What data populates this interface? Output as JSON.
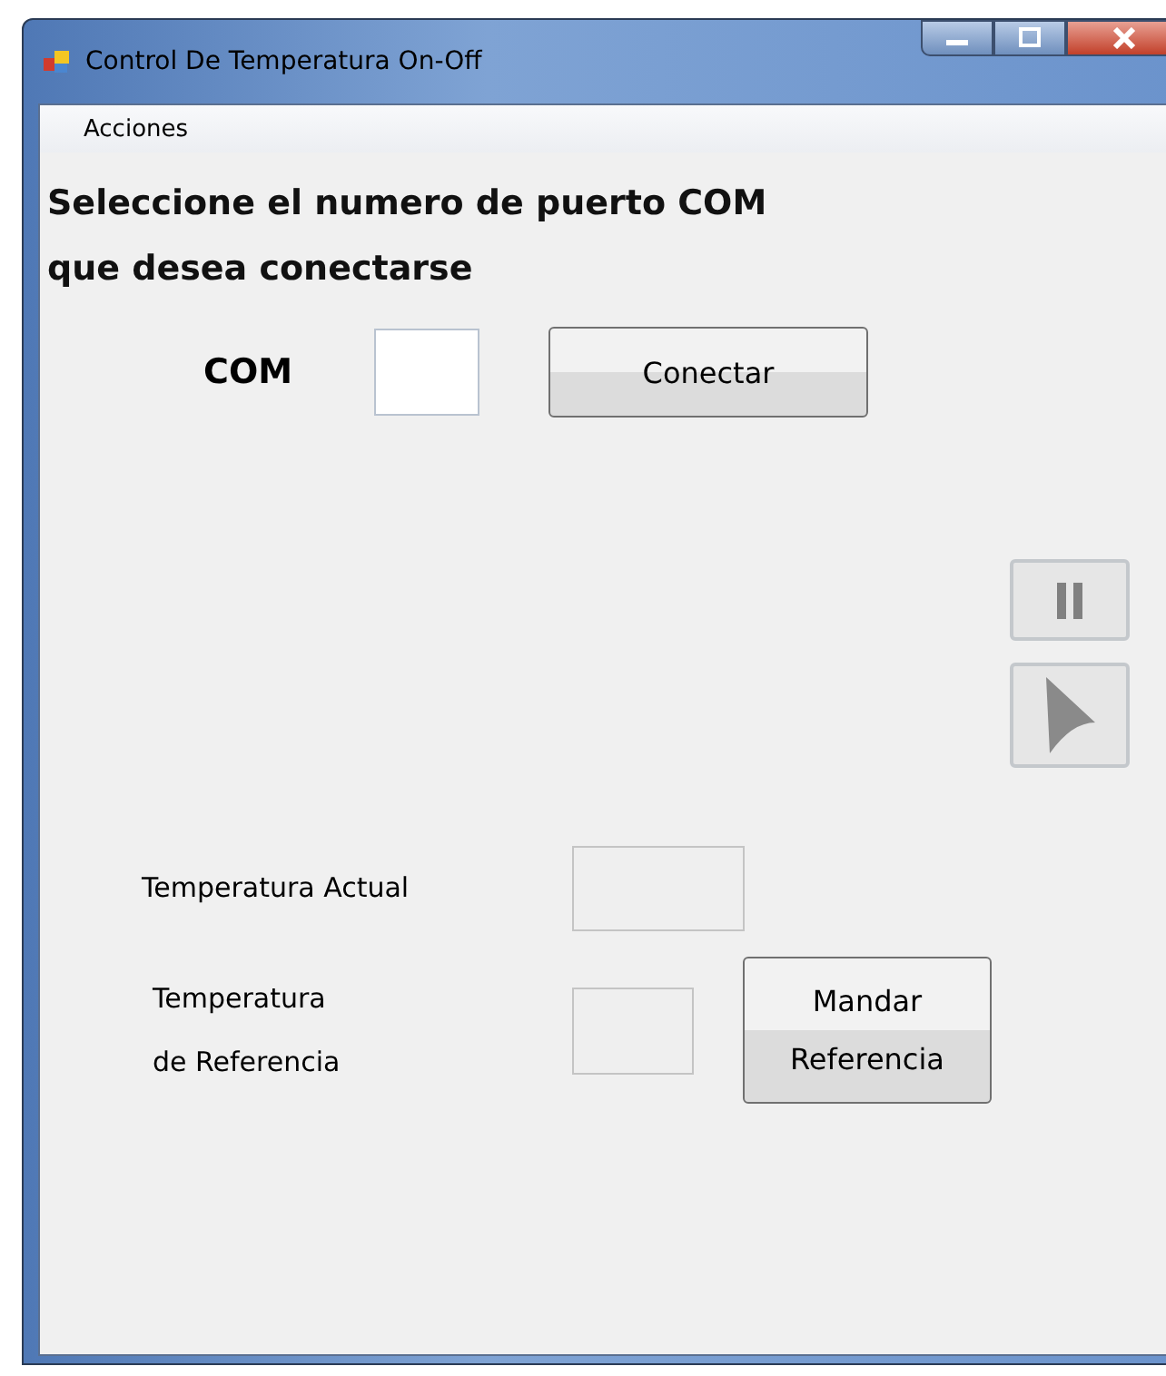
{
  "window": {
    "title": "Control De Temperatura On-Off"
  },
  "menu": [
    {
      "label": "Acciones"
    }
  ],
  "instructions": "Seleccione el numero de puerto COM\nque desea conectarse",
  "com_port": {
    "label": "COM",
    "disabled": false
  },
  "connect_button": {
    "label": "Conectar"
  },
  "playback_buttons": [
    {
      "kind": "pause",
      "disabled": true
    },
    {
      "kind": "play",
      "disabled": true
    }
  ],
  "current_temperature": {
    "label": "Temperatura Actual",
    "disabled": true
  },
  "reference_temperature": {
    "label": "Temperatura\nde Referencia",
    "disabled": true
  },
  "send_button": {
    "label": "Mandar\nReferencia"
  }
}
